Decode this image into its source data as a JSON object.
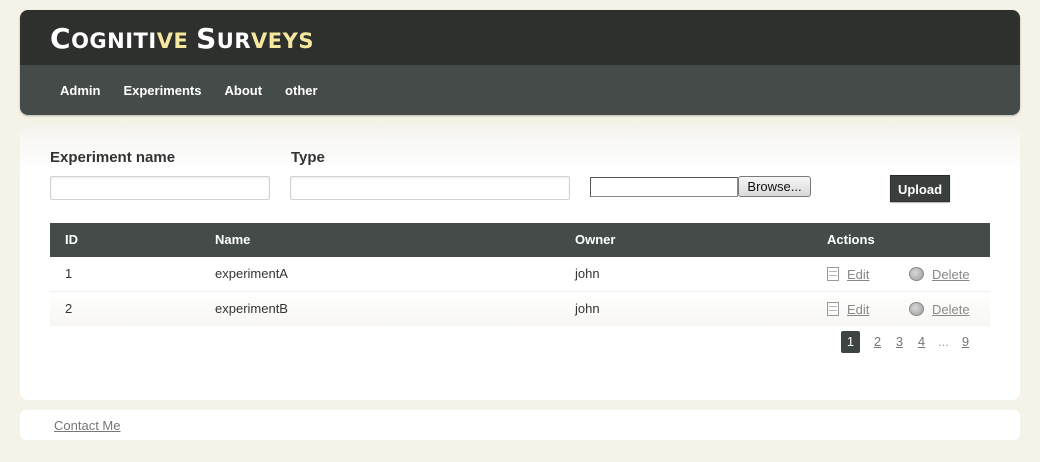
{
  "app": {
    "logo_parts": [
      "C",
      "OGNITI",
      "VE",
      " ",
      "S",
      "UR",
      "VEYS"
    ]
  },
  "nav": {
    "items": [
      "Admin",
      "Experiments",
      "About",
      "other"
    ]
  },
  "form": {
    "experiment_name_label": "Experiment name",
    "experiment_name_value": "",
    "type_label": "Type",
    "type_value": "",
    "file_value": "",
    "browse_label": "Browse...",
    "upload_label": "Upload"
  },
  "table": {
    "headers": [
      "ID",
      "Name",
      "Owner",
      "Actions"
    ],
    "rows": [
      {
        "id": "1",
        "name": "experimentA",
        "owner": "john",
        "edit": "Edit",
        "delete": "Delete"
      },
      {
        "id": "2",
        "name": "experimentB",
        "owner": "john",
        "edit": "Edit",
        "delete": "Delete"
      }
    ]
  },
  "pagination": {
    "pages": [
      "1",
      "2",
      "3",
      "4",
      "...",
      "9"
    ],
    "current": "1"
  },
  "footer": {
    "contact_label": "Contact Me"
  },
  "colors": {
    "header_dark": "#2e302e",
    "nav_bg": "#454b48",
    "logo_highlight": "#f6e7a0",
    "page_bg": "#f5f3e7"
  }
}
